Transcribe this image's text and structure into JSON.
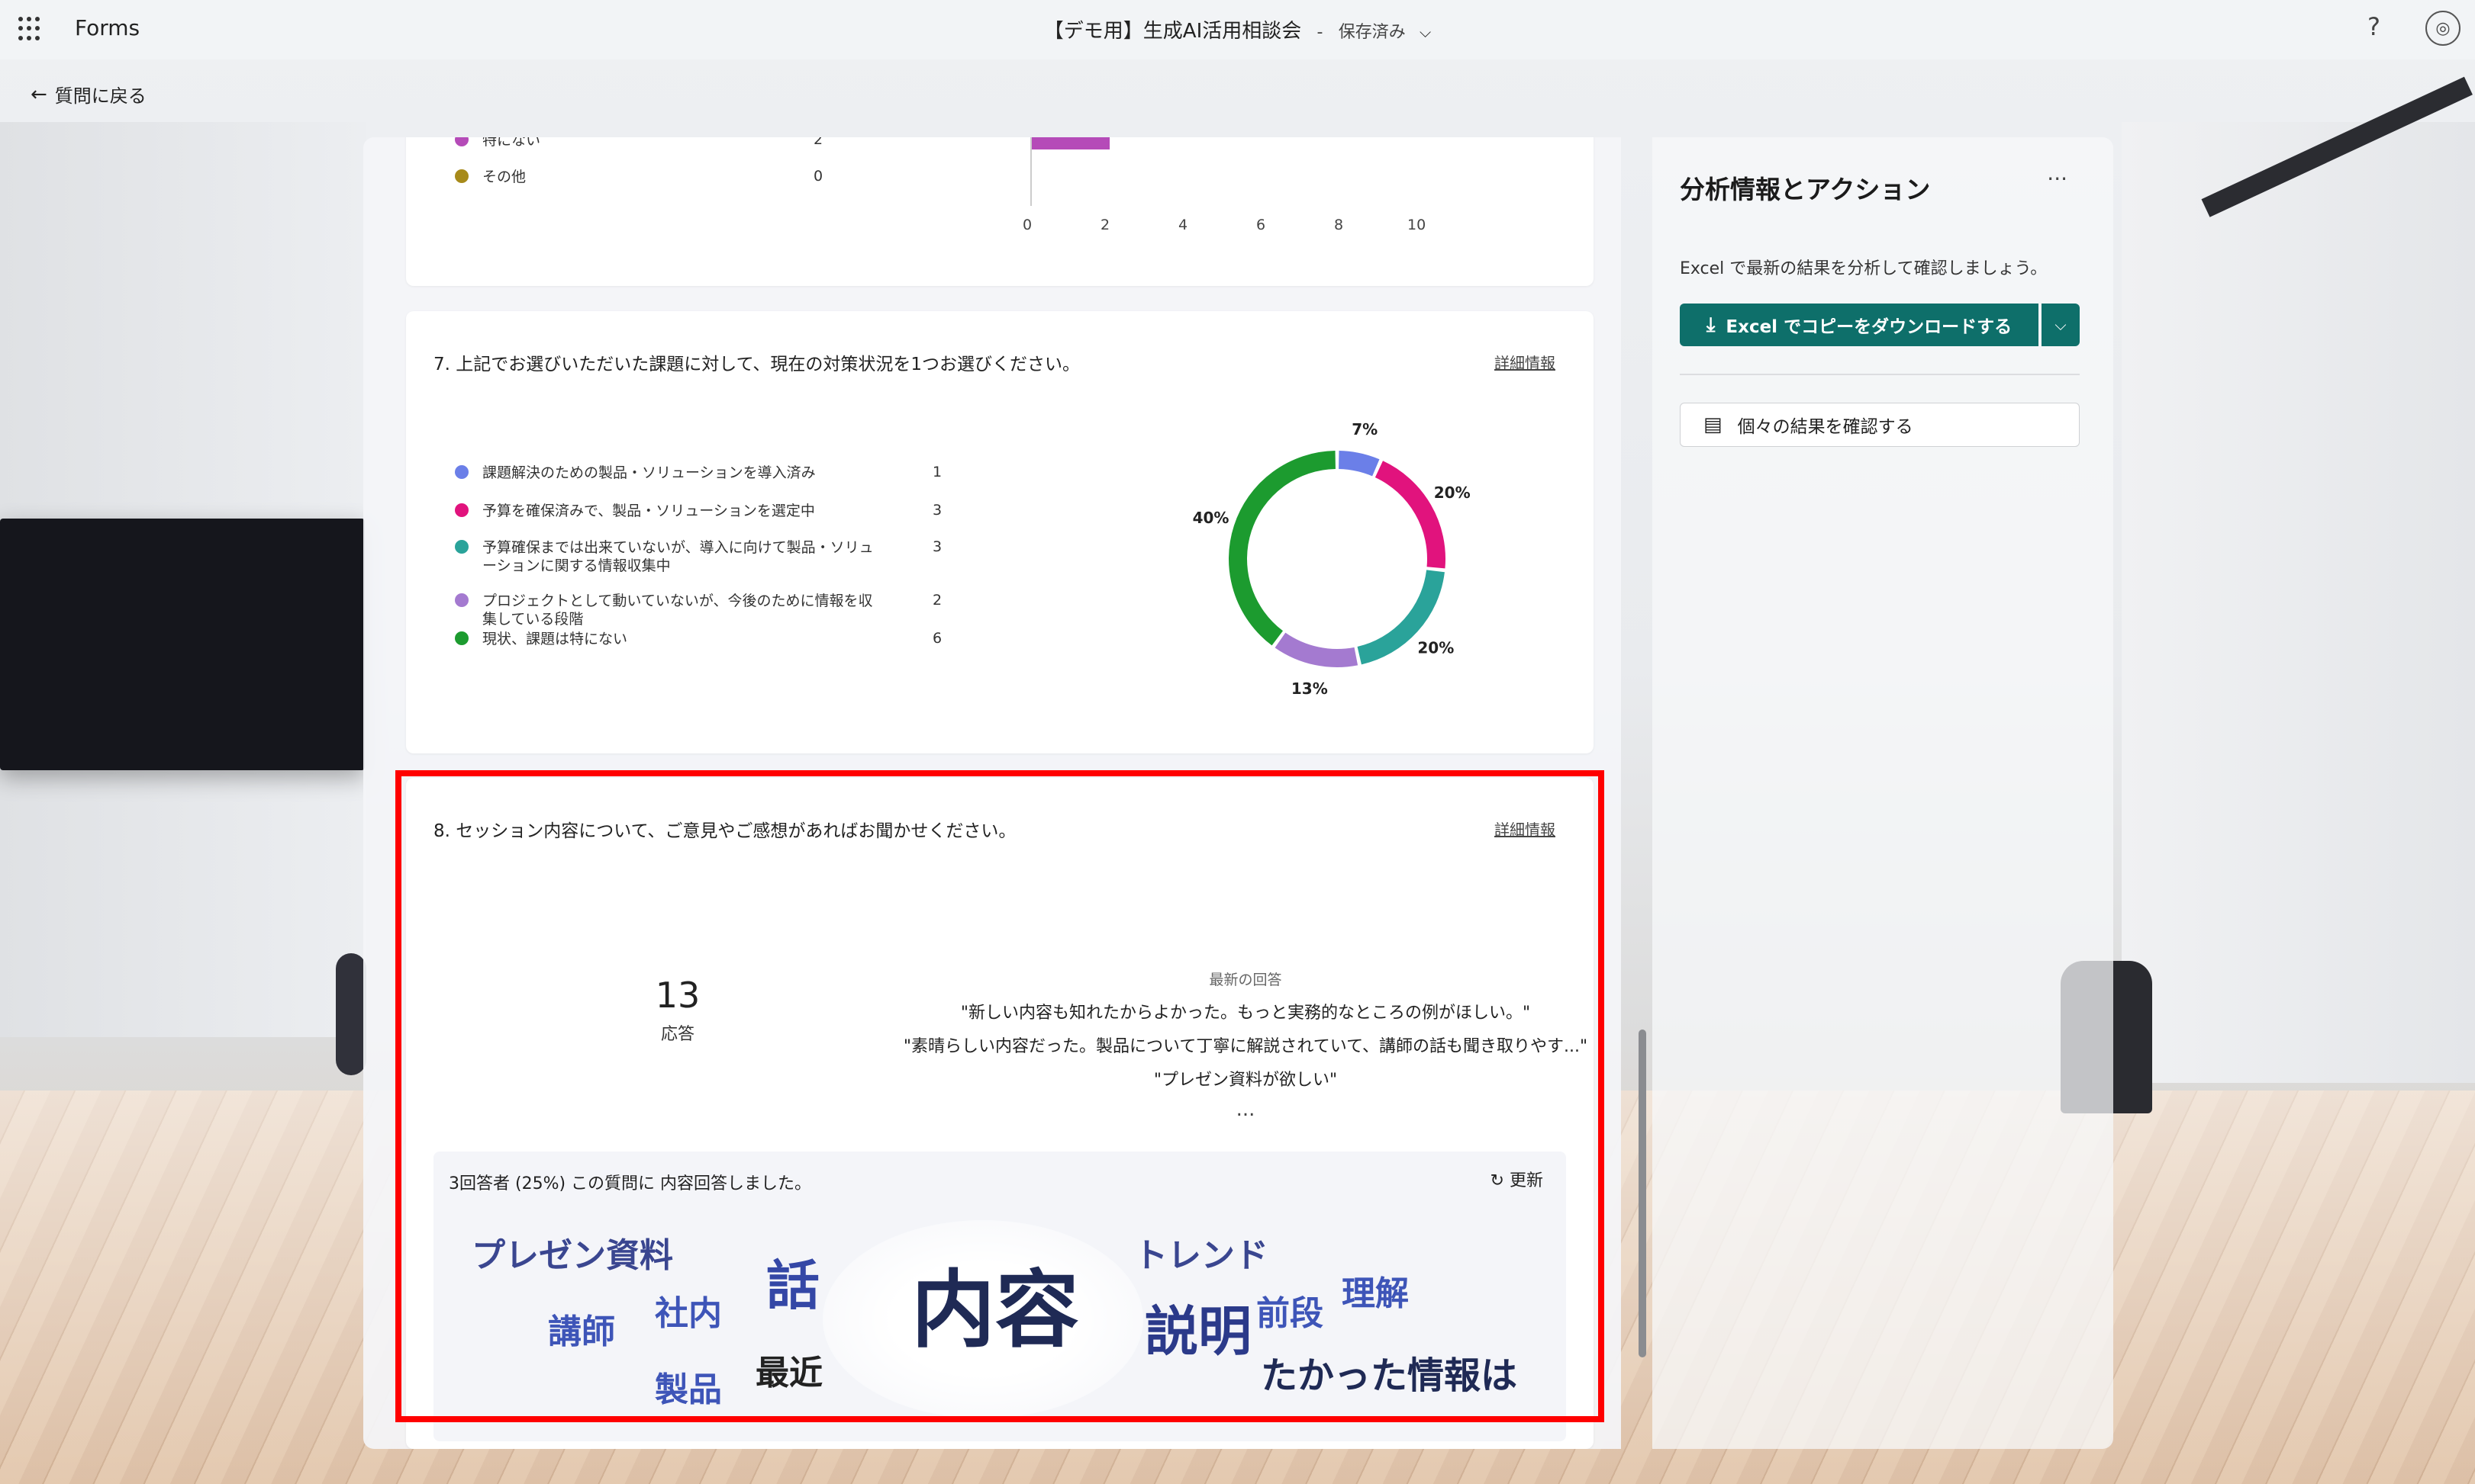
{
  "app": {
    "name": "Forms"
  },
  "document": {
    "title": "【デモ用】生成AI活用相談会",
    "separator": "-",
    "saved_status": "保存済み"
  },
  "nav": {
    "back_label": "質問に戻る"
  },
  "question6_tail": {
    "legend": [
      {
        "label": "特にない",
        "count": "2",
        "color": "#b54bb8"
      },
      {
        "label": "その他",
        "count": "0",
        "color": "#a78a1a"
      }
    ],
    "axis_ticks": [
      "0",
      "2",
      "4",
      "6",
      "8",
      "10"
    ]
  },
  "question7": {
    "title": "7. 上記でお選びいただいた課題に対して、現在の対策状況を1つお選びください。",
    "detail_link": "詳細情報",
    "legend": [
      {
        "label": "課題解決のための製品・ソリューションを導入済み",
        "count": "1",
        "color": "#6b7fe8"
      },
      {
        "label": "予算を確保済みで、製品・ソリューションを選定中",
        "count": "3",
        "color": "#e1137d"
      },
      {
        "label": "予算確保までは出来ていないが、導入に向けて製品・ソリューションに関する情報収集中",
        "count": "3",
        "color": "#2aa39a"
      },
      {
        "label": "プロジェクトとして動いていないが、今後のために情報を収集している段階",
        "count": "2",
        "color": "#a47ad0"
      },
      {
        "label": "現状、課題は特にない",
        "count": "6",
        "color": "#1c9b2f"
      }
    ]
  },
  "chart_data": {
    "type": "pie",
    "categories": [
      "課題解決のための製品・ソリューションを導入済み",
      "予算を確保済みで、製品・ソリューションを選定中",
      "予算確保までは出来ていないが、導入に向けて製品・ソリューションに関する情報収集中",
      "プロジェクトとして動いていないが、今後のために情報を収集している段階",
      "現状、課題は特にない"
    ],
    "values": [
      1,
      3,
      3,
      2,
      6
    ],
    "labels": [
      "7%",
      "20%",
      "20%",
      "13%",
      "40%"
    ],
    "colors": [
      "#6b7fe8",
      "#e1137d",
      "#2aa39a",
      "#a47ad0",
      "#1c9b2f"
    ]
  },
  "question8": {
    "title": "8. セッション内容について、ご意見やご感想があればお聞かせください。",
    "detail_link": "詳細情報",
    "response_count": "13",
    "response_label": "応答",
    "latest_heading": "最新の回答",
    "latest_responses": [
      "\"新しい内容も知れたからよかった。もっと実務的なところの例がほしい。\"",
      "\"素晴らしい内容だった。製品について丁寧に解説されていて、講師の話も聞き取りやす...\"",
      "\"プレゼン資料が欲しい\""
    ],
    "ellipsis": "...",
    "cloud_summary": "3回答者 (25%) この質問に 内容回答しました。",
    "refresh_label": "更新",
    "words": [
      "プレゼン資料",
      "話",
      "内容",
      "トレンド",
      "理解",
      "講師",
      "社内",
      "説明",
      "前段",
      "製品",
      "最近",
      "たかった情報は"
    ]
  },
  "side_panel": {
    "title": "分析情報とアクション",
    "description": "Excel で最新の結果を分析して確認しましょう。",
    "excel_button": "Excel でコピーをダウンロードする",
    "individual_button": "個々の結果を確認する"
  }
}
